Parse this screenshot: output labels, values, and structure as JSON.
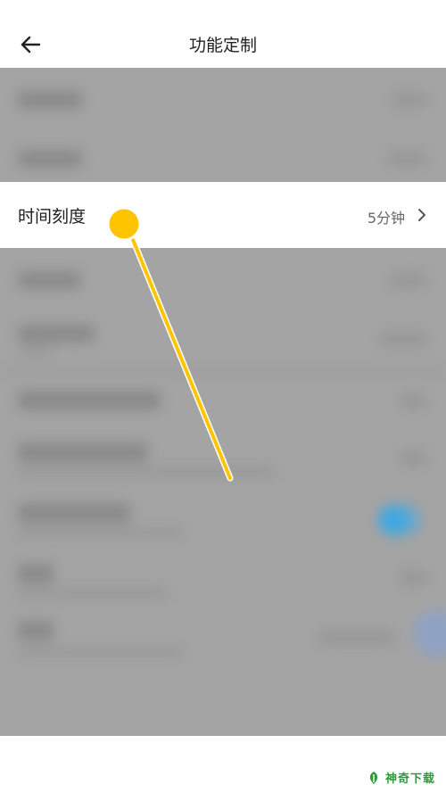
{
  "header": {
    "back_icon": "arrow-left-icon",
    "title": "功能定制"
  },
  "highlighted_row": {
    "label": "时间刻度",
    "value": "5分钟",
    "chevron_icon": "chevron-right-icon"
  },
  "watermark": {
    "logo_icon": "leaf-logo-icon",
    "text": "神奇下载"
  },
  "colors": {
    "overlay": "#a4a4a4",
    "pointer_yellow": "#ffc400",
    "watermark_green": "#2f9a3c",
    "blurred_toggle_blue": "#3fa8e0"
  }
}
